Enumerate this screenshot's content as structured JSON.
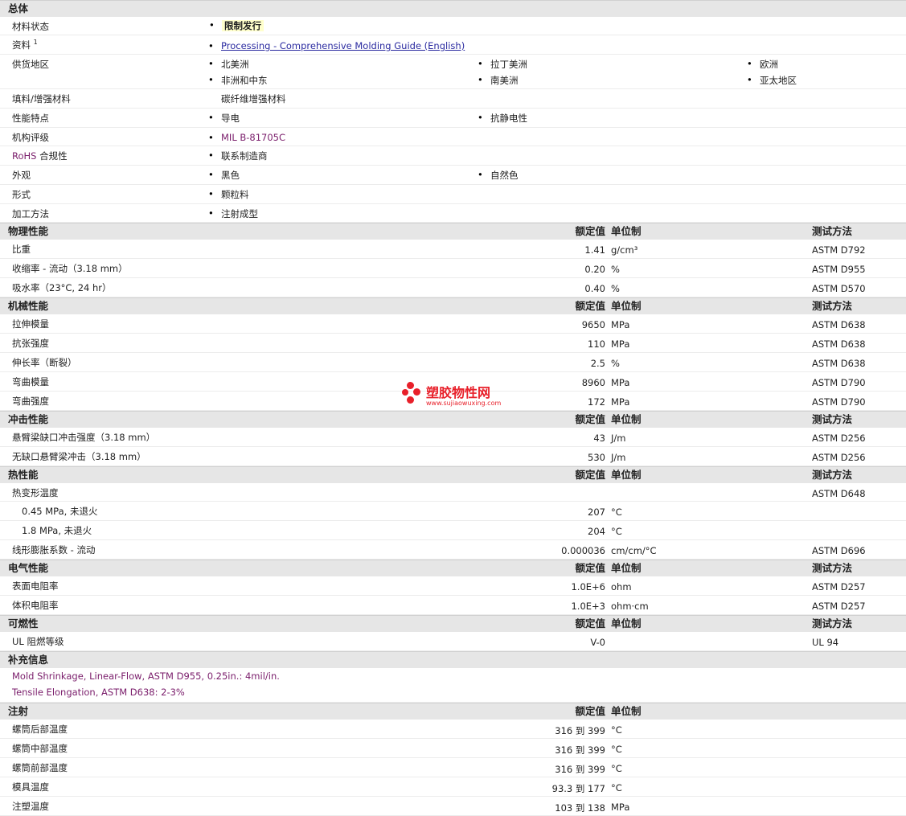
{
  "general": {
    "title": "总体",
    "status_label": "材料状态",
    "status_value": "限制发行",
    "doc_label": "资料",
    "doc_sup": "1",
    "doc_link": "Processing - Comprehensive Molding Guide (English)",
    "region_label": "供货地区",
    "regions": [
      "北美洲",
      "拉丁美洲",
      "欧洲",
      "非洲和中东",
      "南美洲",
      "亚太地区"
    ],
    "filler_label": "填料/增强材料",
    "filler_value": "碳纤维增强材料",
    "feature_label": "性能特点",
    "features": [
      "导电",
      "抗静电性"
    ],
    "agency_label": "机构评级",
    "agency_value": "MIL B-81705C",
    "rohs_label_a": "RoHS",
    "rohs_label_b": " 合规性",
    "rohs_value": "联系制造商",
    "appearance_label": "外观",
    "appearance": [
      "黑色",
      "自然色"
    ],
    "form_label": "形式",
    "form_value": "颗粒料",
    "process_label": "加工方法",
    "process_value": "注射成型"
  },
  "headers": {
    "value": "额定值",
    "unit": "单位制",
    "method": "测试方法"
  },
  "physical": {
    "title": "物理性能",
    "rows": [
      {
        "label": "比重",
        "value": "1.41",
        "unit": "g/cm³",
        "method": "ASTM D792"
      },
      {
        "label": "收缩率 - 流动（3.18 mm）",
        "value": "0.20",
        "unit": "%",
        "method": "ASTM D955"
      },
      {
        "label": "吸水率（23°C, 24 hr）",
        "value": "0.40",
        "unit": "%",
        "method": "ASTM D570"
      }
    ]
  },
  "mechanical": {
    "title": "机械性能",
    "rows": [
      {
        "label": "拉伸模量",
        "value": "9650",
        "unit": "MPa",
        "method": "ASTM D638"
      },
      {
        "label": "抗张强度",
        "value": "110",
        "unit": "MPa",
        "method": "ASTM D638"
      },
      {
        "label": "伸长率（断裂）",
        "value": "2.5",
        "unit": "%",
        "method": "ASTM D638"
      },
      {
        "label": "弯曲模量",
        "value": "8960",
        "unit": "MPa",
        "method": "ASTM D790"
      },
      {
        "label": "弯曲强度",
        "value": "172",
        "unit": "MPa",
        "method": "ASTM D790"
      }
    ]
  },
  "impact": {
    "title": "冲击性能",
    "rows": [
      {
        "label": "悬臂梁缺口冲击强度（3.18 mm）",
        "value": "43",
        "unit": "J/m",
        "method": "ASTM D256"
      },
      {
        "label": "无缺口悬臂梁冲击（3.18 mm）",
        "value": "530",
        "unit": "J/m",
        "method": "ASTM D256"
      }
    ]
  },
  "thermal": {
    "title": "热性能",
    "hdt_label": "热变形温度",
    "hdt_method": "ASTM D648",
    "rows": [
      {
        "label": "0.45 MPa, 未退火",
        "value": "207",
        "unit": "°C",
        "method": ""
      },
      {
        "label": "1.8 MPa, 未退火",
        "value": "204",
        "unit": "°C",
        "method": ""
      }
    ],
    "clte_label": "线形膨胀系数 - 流动",
    "clte_value": "0.000036",
    "clte_unit": "cm/cm/°C",
    "clte_method": "ASTM D696"
  },
  "electrical": {
    "title": "电气性能",
    "rows": [
      {
        "label": "表面电阻率",
        "value": "1.0E+6",
        "unit": "ohm",
        "method": "ASTM D257"
      },
      {
        "label": "体积电阻率",
        "value": "1.0E+3",
        "unit": "ohm·cm",
        "method": "ASTM D257"
      }
    ]
  },
  "flammability": {
    "title": "可燃性",
    "rows": [
      {
        "label": "UL 阻燃等级",
        "value": "V-0",
        "unit": "",
        "method": "UL 94"
      }
    ]
  },
  "supplement": {
    "title": "补充信息",
    "lines": [
      "Mold Shrinkage, Linear-Flow, ASTM D955, 0.25in.: 4mil/in.",
      "Tensile Elongation, ASTM D638: 2-3%"
    ]
  },
  "injection": {
    "title": "注射",
    "rows": [
      {
        "label": "螺筒后部温度",
        "value": "316 到  399",
        "unit": "°C"
      },
      {
        "label": "螺筒中部温度",
        "value": "316 到  399",
        "unit": "°C"
      },
      {
        "label": "螺筒前部温度",
        "value": "316 到  399",
        "unit": "°C"
      },
      {
        "label": "模具温度",
        "value": "93.3 到  177",
        "unit": "°C"
      },
      {
        "label": "注塑温度",
        "value": "103 到  138",
        "unit": "MPa"
      }
    ]
  },
  "watermark": {
    "name": "塑胶物性网",
    "url": "www.sujiaowuxing.com",
    "color": "#e8202a"
  }
}
